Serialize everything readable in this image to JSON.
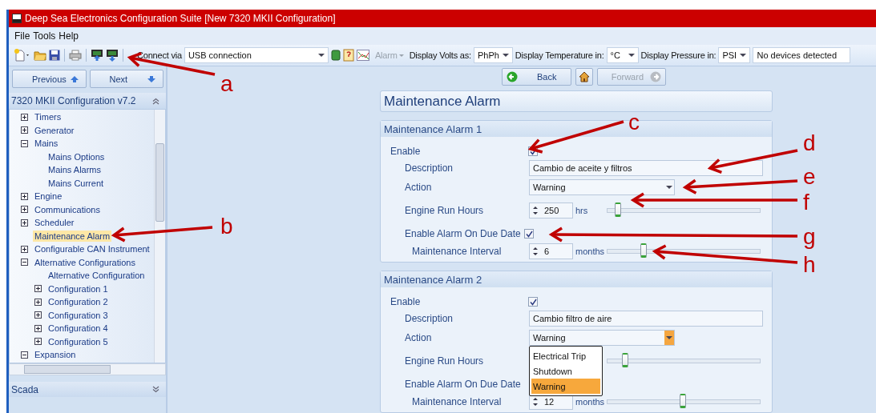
{
  "window": {
    "title": "Deep Sea Electronics Configuration Suite [New 7320 MKII Configuration]"
  },
  "menu": [
    "File",
    "Tools",
    "Help"
  ],
  "toolbar": {
    "connect_label": "Connect via",
    "connection": "USB connection",
    "alarm": {
      "label": "Alarm",
      "disabled": true
    },
    "selectors": [
      {
        "label": "Display Volts as:",
        "value": "PhPh"
      },
      {
        "label": "Display Temperature in:",
        "value": "°C"
      },
      {
        "label": "Display Pressure in:",
        "value": "PSI"
      }
    ],
    "status": "No devices detected"
  },
  "nav": {
    "previous": "Previous",
    "next": "Next"
  },
  "tree_header": "7320 MKII Configuration v7.2",
  "tree": [
    {
      "label": "Timers",
      "expanded": false,
      "selected": false
    },
    {
      "label": "Generator",
      "expanded": false,
      "selected": false
    },
    {
      "label": "Mains",
      "expanded": true,
      "selected": false,
      "children": [
        {
          "label": "Mains Options",
          "selected": false
        },
        {
          "label": "Mains Alarms",
          "selected": false
        },
        {
          "label": "Mains Current",
          "selected": false
        }
      ]
    },
    {
      "label": "Engine",
      "expanded": false,
      "selected": false
    },
    {
      "label": "Communications",
      "expanded": false,
      "selected": false
    },
    {
      "label": "Scheduler",
      "expanded": false,
      "selected": false
    },
    {
      "label": "Maintenance Alarm",
      "selected": true
    },
    {
      "label": "Configurable CAN Instrument",
      "expanded": false,
      "selected": false
    },
    {
      "label": "Alternative Configurations",
      "expanded": true,
      "selected": false,
      "children": [
        {
          "label": "Alternative Configuration",
          "selected": false
        },
        {
          "label": "Configuration 1",
          "expanded": false,
          "selected": false
        },
        {
          "label": "Configuration 2",
          "expanded": false,
          "selected": false
        },
        {
          "label": "Configuration 3",
          "expanded": false,
          "selected": false
        },
        {
          "label": "Configuration 4",
          "expanded": false,
          "selected": false
        },
        {
          "label": "Configuration 5",
          "expanded": false,
          "selected": false
        }
      ]
    },
    {
      "label": "Expansion",
      "expanded": true,
      "selected": false
    }
  ],
  "scada": "Scada",
  "page_nav": {
    "back": "Back",
    "forward": {
      "label": "Forward",
      "disabled": true
    }
  },
  "page_title": "Maintenance Alarm",
  "alarms": [
    {
      "title": "Maintenance Alarm 1",
      "enable": {
        "label": "Enable",
        "checked": true
      },
      "description": {
        "label": "Description",
        "value": "Cambio de aceite y filtros"
      },
      "action": {
        "label": "Action",
        "value": "Warning"
      },
      "run_hours": {
        "label": "Engine Run Hours",
        "value": "250",
        "unit": "hrs",
        "level": 0.05
      },
      "due_date": {
        "label": "Enable Alarm On Due Date",
        "checked": true
      },
      "interval": {
        "label": "Maintenance Interval",
        "value": "6",
        "unit": "months",
        "level": 0.22
      }
    },
    {
      "title": "Maintenance Alarm 2",
      "enable": {
        "label": "Enable",
        "checked": true
      },
      "description": {
        "label": "Description",
        "value": "Cambio filtro de aire"
      },
      "action": {
        "label": "Action",
        "value": "Warning",
        "options": [
          {
            "label": "Electrical Trip",
            "selected": false
          },
          {
            "label": "Shutdown",
            "selected": false
          },
          {
            "label": "Warning",
            "selected": true
          }
        ]
      },
      "run_hours": {
        "label": "Engine Run Hours",
        "level": 0.1
      },
      "due_date": {
        "label": "Enable Alarm On Due Date"
      },
      "interval": {
        "label": "Maintenance Interval",
        "value": "12",
        "unit": "months",
        "level": 0.48
      }
    }
  ],
  "annotations": [
    {
      "label": "a"
    },
    {
      "label": "b"
    },
    {
      "label": "c"
    },
    {
      "label": "d"
    },
    {
      "label": "e"
    },
    {
      "label": "f"
    },
    {
      "label": "g"
    },
    {
      "label": "h"
    }
  ]
}
